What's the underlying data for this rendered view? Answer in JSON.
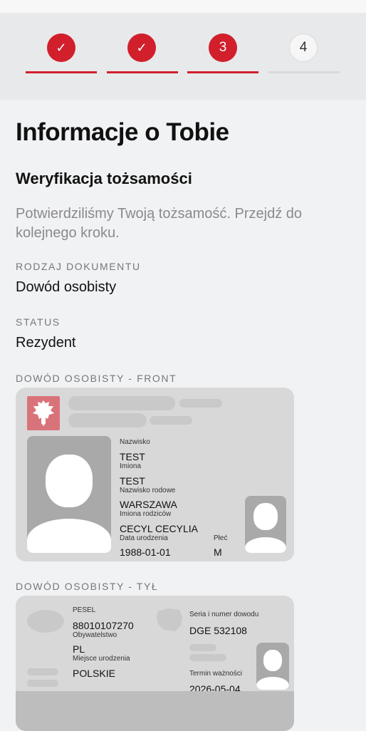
{
  "stepper": {
    "steps": [
      {
        "state": "done",
        "label": "✓"
      },
      {
        "state": "done",
        "label": "✓"
      },
      {
        "state": "active",
        "label": "3"
      },
      {
        "state": "todo",
        "label": "4"
      }
    ]
  },
  "page": {
    "title": "Informacje o Tobie",
    "subtitle": "Weryfikacja tożsamości",
    "description": "Potwierdziliśmy Twoją tożsamość. Przejdź do kolejnego kroku."
  },
  "fields": {
    "doc_type_label": "RODZAJ DOKUMENTU",
    "doc_type_value": "Dowód osobisty",
    "status_label": "STATUS",
    "status_value": "Rezydent"
  },
  "front": {
    "section_label": "DOWÓD OSOBISTY - FRONT",
    "surname_label": "Nazwisko",
    "surname": "TEST",
    "names_label": "Imiona",
    "names": "TEST",
    "family_name_label": "Nazwisko rodowe",
    "family_name": "WARSZAWA",
    "parents_label": "Imiona rodziców",
    "parents": "CECYL CECYLIA",
    "birth_label": "Data urodzenia",
    "birth": "1988-01-01",
    "sex_label": "Płeć",
    "sex": "M"
  },
  "back": {
    "section_label": "DOWÓD OSOBISTY - TYŁ",
    "pesel_label": "PESEL",
    "pesel": "88010107270",
    "citizenship_label": "Obywatelstwo",
    "citizenship": "PL",
    "birthplace_label": "Miejsce urodzenia",
    "birthplace": "POLSKIE",
    "series_label": "Seria i numer dowodu",
    "series": "DGE 532108",
    "expiry_label": "Termin ważności",
    "expiry": "2026-05-04"
  }
}
